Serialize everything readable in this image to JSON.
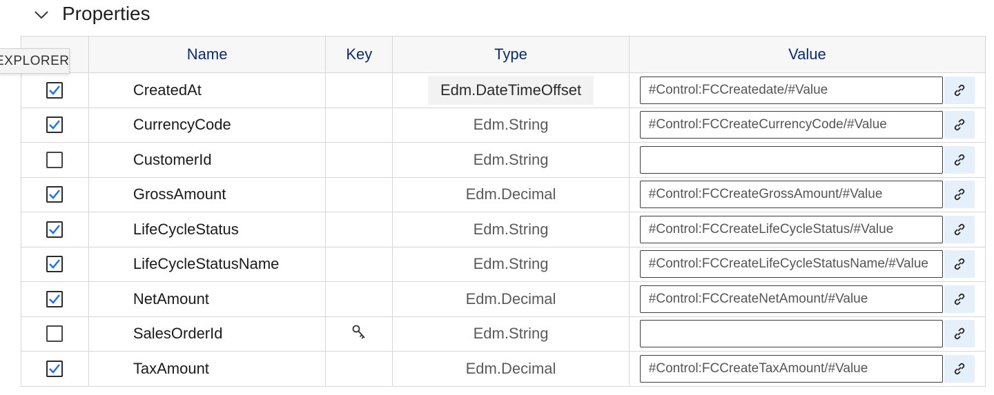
{
  "section": {
    "title": "Properties",
    "chevron_icon": "chevron-down-icon"
  },
  "explorer_tab": {
    "label": "EXPLORER"
  },
  "table": {
    "headers": {
      "name": "Name",
      "key": "Key",
      "type": "Type",
      "value": "Value"
    },
    "rows": [
      {
        "checked": true,
        "name": "CreatedAt",
        "key": "",
        "type": "Edm.DateTimeOffset",
        "value": "#Control:FCCreatedate/#Value"
      },
      {
        "checked": true,
        "name": "CurrencyCode",
        "key": "",
        "type": "Edm.String",
        "value": "#Control:FCCreateCurrencyCode/#Value"
      },
      {
        "checked": false,
        "name": "CustomerId",
        "key": "",
        "type": "Edm.String",
        "value": ""
      },
      {
        "checked": true,
        "name": "GrossAmount",
        "key": "",
        "type": "Edm.Decimal",
        "value": "#Control:FCCreateGrossAmount/#Value"
      },
      {
        "checked": true,
        "name": "LifeCycleStatus",
        "key": "",
        "type": "Edm.String",
        "value": "#Control:FCCreateLifeCycleStatus/#Value"
      },
      {
        "checked": true,
        "name": "LifeCycleStatusName",
        "key": "",
        "type": "Edm.String",
        "value": "#Control:FCCreateLifeCycleStatusName/#Value"
      },
      {
        "checked": true,
        "name": "NetAmount",
        "key": "",
        "type": "Edm.Decimal",
        "value": "#Control:FCCreateNetAmount/#Value"
      },
      {
        "checked": false,
        "name": "SalesOrderId",
        "key": "key-icon",
        "type": "Edm.String",
        "value": ""
      },
      {
        "checked": true,
        "name": "TaxAmount",
        "key": "",
        "type": "Edm.Decimal",
        "value": "#Control:FCCreateTaxAmount/#Value"
      }
    ]
  },
  "colors": {
    "header_text": "#0b2a6b",
    "checkmark": "#1a73e8",
    "link_button_bg": "#e6f0fb",
    "border": "#d6d6d6"
  }
}
